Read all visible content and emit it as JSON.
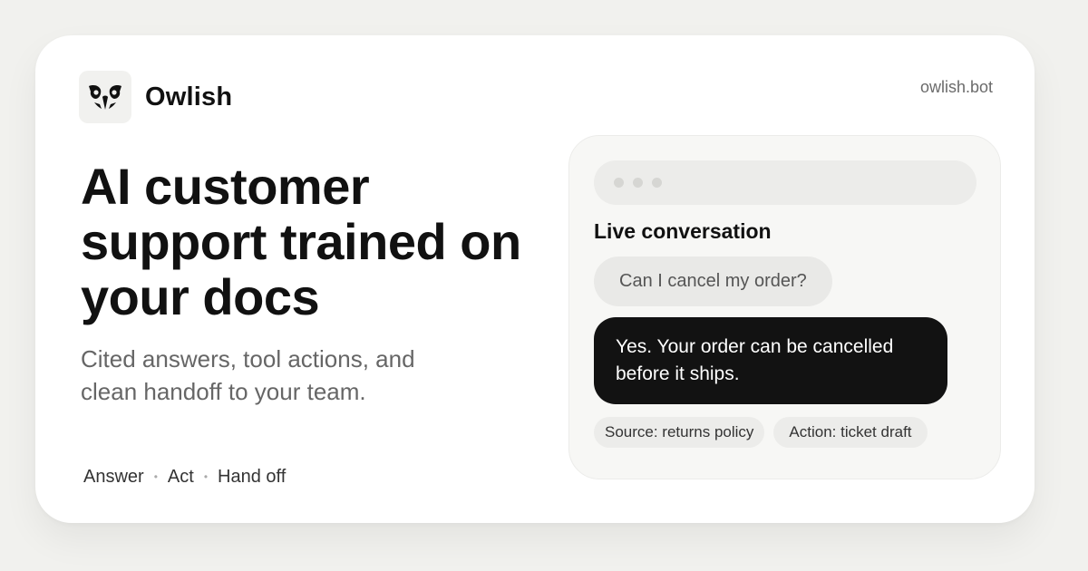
{
  "brand": {
    "name": "Owlish",
    "icon": "owl-icon",
    "domain": "owlish.bot"
  },
  "hero": {
    "headline": "AI customer support trained on your docs",
    "subhead": "Cited answers, tool actions, and clean handoff to your team.",
    "features": [
      "Answer",
      "Act",
      "Hand off"
    ],
    "separator": "•"
  },
  "chat": {
    "title": "Live conversation",
    "user_message": "Can I cancel my order?",
    "bot_message": "Yes. Your order can be cancelled before it ships.",
    "chips": [
      "Source: returns policy",
      "Action: ticket draft"
    ]
  },
  "colors": {
    "background": "#f1f1ee",
    "card": "#ffffff",
    "bot_bubble": "#121212",
    "user_bubble": "#e9e9e7"
  }
}
